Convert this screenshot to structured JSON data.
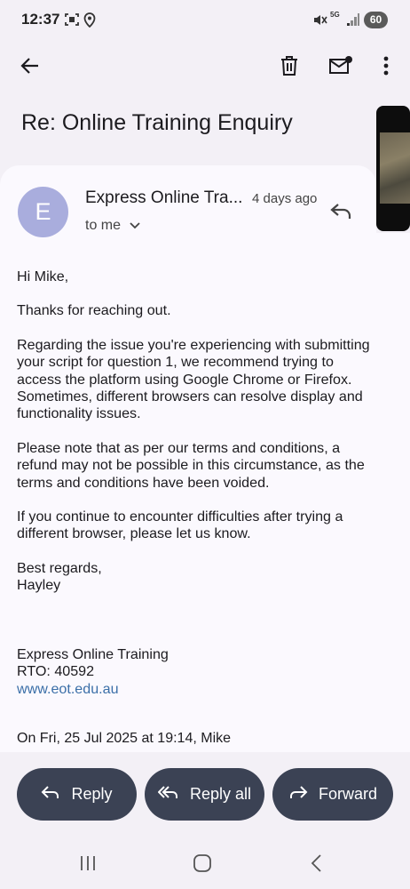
{
  "status_bar": {
    "time": "12:37",
    "battery": "60",
    "network": "5G"
  },
  "app_bar": {
    "back_icon": "arrow-back-icon",
    "delete_icon": "trash-icon",
    "unread_icon": "mark-unread-icon",
    "more_icon": "more-vert-icon"
  },
  "email": {
    "subject": "Re: Online Training Enquiry",
    "avatar_letter": "E",
    "sender": "Express Online Tra...",
    "date": "4 days ago",
    "recipient": "to me",
    "body": [
      "Hi Mike,",
      "Thanks for reaching out.",
      "Regarding the issue you're experiencing with submitting your script for question 1, we recommend trying to access the platform using Google Chrome or Firefox. Sometimes, different browsers can resolve display and functionality issues.",
      "Please note that as per our terms and conditions, a refund may not be possible in this circumstance, as the terms and conditions have been voided.",
      "If you continue to encounter difficulties after trying a different browser, please let us know."
    ],
    "closing": "Best regards,",
    "closing_name": "Hayley",
    "signature": {
      "org": "Express Online Training",
      "rto": "RTO: 40592",
      "website": "www.eot.edu.au"
    },
    "quote_header": "On Fri, 25 Jul 2025 at 19:14, Mike"
  },
  "actions": {
    "reply": "Reply",
    "reply_all": "Reply all",
    "forward": "Forward"
  },
  "colors": {
    "background": "#f3f0f6",
    "card": "#fbf9fe",
    "avatar": "#a9addd",
    "button": "#3b4254",
    "link": "#3b6fa8"
  }
}
